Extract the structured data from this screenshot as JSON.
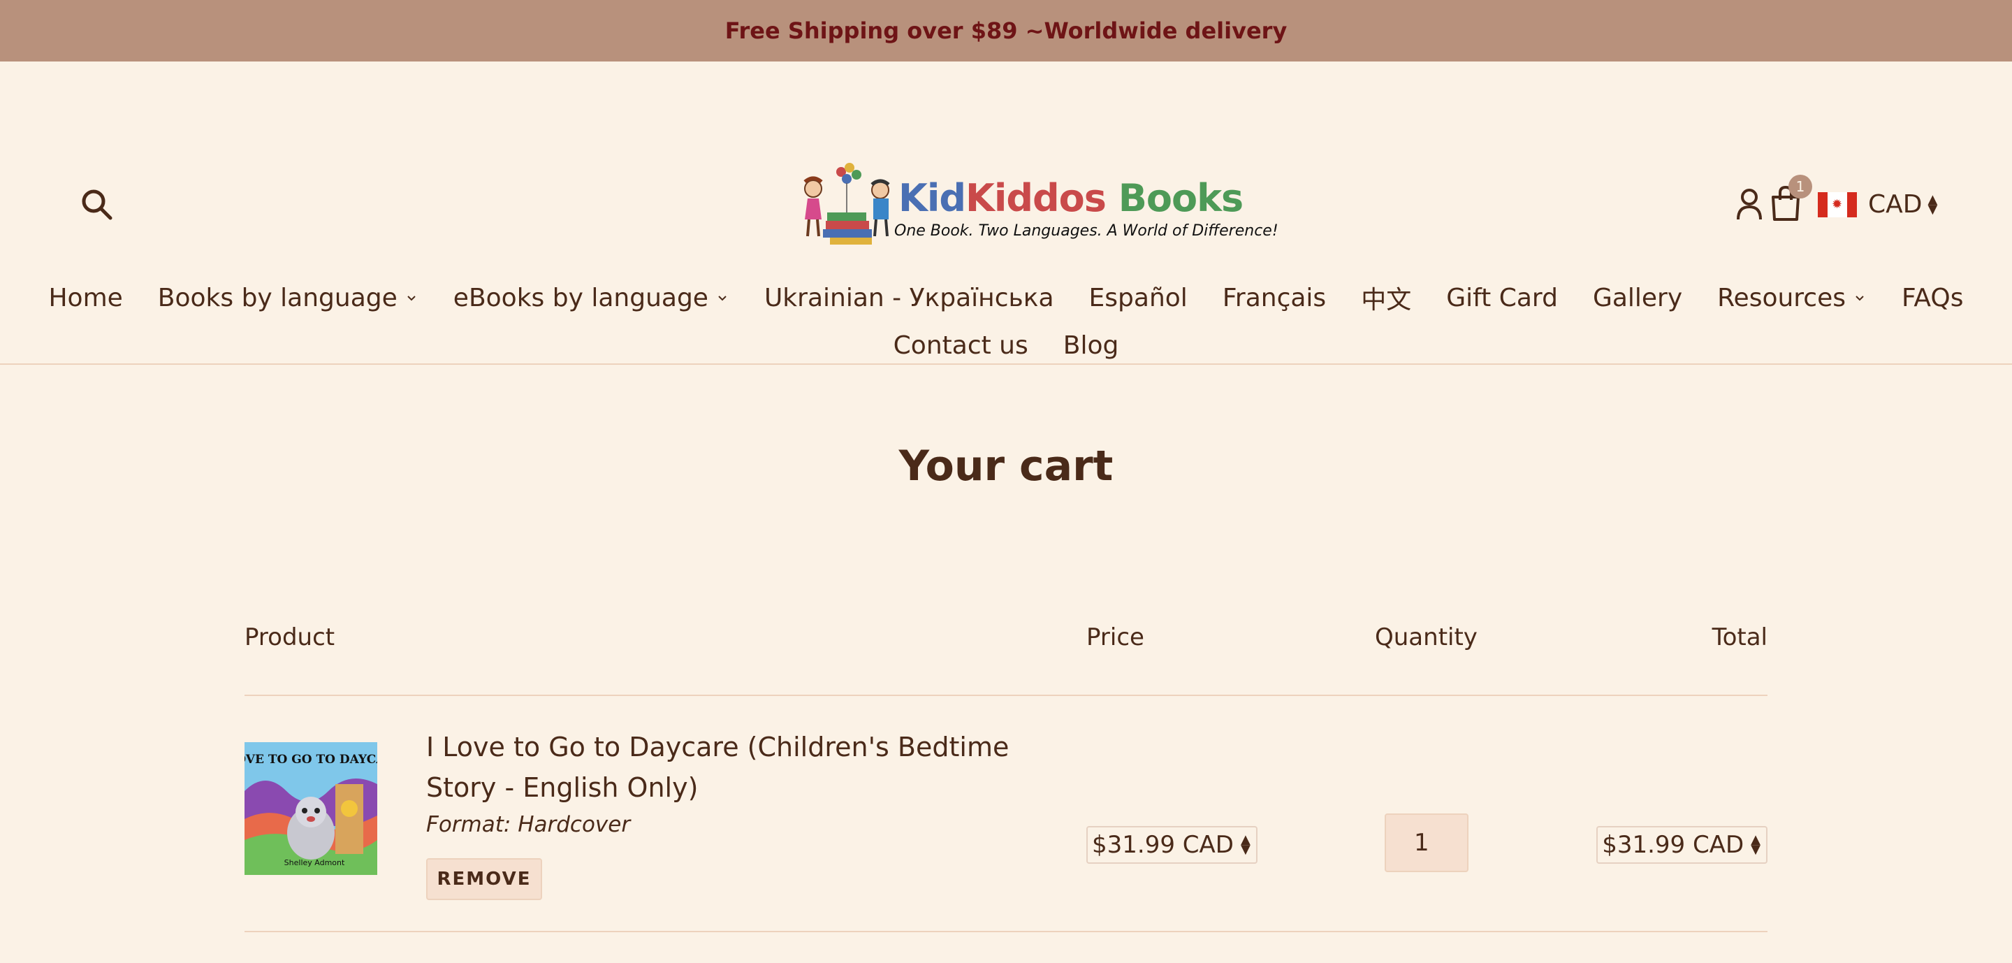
{
  "announcement": "Free Shipping over $89 ~Worldwide delivery",
  "header": {
    "logo": {
      "title_part1": "Kid",
      "title_part2": "Kiddos",
      "title_part3": " Books",
      "tagline": "One Book. Two Languages. A World of Difference!"
    },
    "cart_count": "1",
    "currency": "CAD"
  },
  "nav": {
    "row1": [
      {
        "label": "Home"
      },
      {
        "label": "Books by language"
      },
      {
        "label": "eBooks by language"
      },
      {
        "label": "Ukrainian - Українська"
      },
      {
        "label": "Español"
      },
      {
        "label": "Français"
      },
      {
        "label": "中文"
      },
      {
        "label": "Gift Card"
      },
      {
        "label": "Gallery"
      },
      {
        "label": "Resources"
      },
      {
        "label": "FAQs"
      }
    ],
    "row2": [
      {
        "label": "Contact us"
      },
      {
        "label": "Blog"
      }
    ]
  },
  "cart": {
    "title": "Your cart",
    "columns": {
      "product": "Product",
      "price": "Price",
      "quantity": "Quantity",
      "total": "Total"
    },
    "items": [
      {
        "name": "I Love to Go to Daycare (Children's Bedtime Story - English Only)",
        "format": "Format: Hardcover",
        "remove_label": "REMOVE",
        "price": "$31.99 CAD",
        "quantity": "1",
        "total": "$31.99 CAD",
        "thumb_title": "I LOVE TO GO TO DAYCARE",
        "thumb_author": "Shelley Admont"
      }
    ]
  },
  "colors": {
    "background": "#fbf2e6",
    "announcement_bar": "#b8917c",
    "announcement_text": "#6e1416",
    "text": "#4a2a19",
    "rule": "#edd2bd"
  }
}
